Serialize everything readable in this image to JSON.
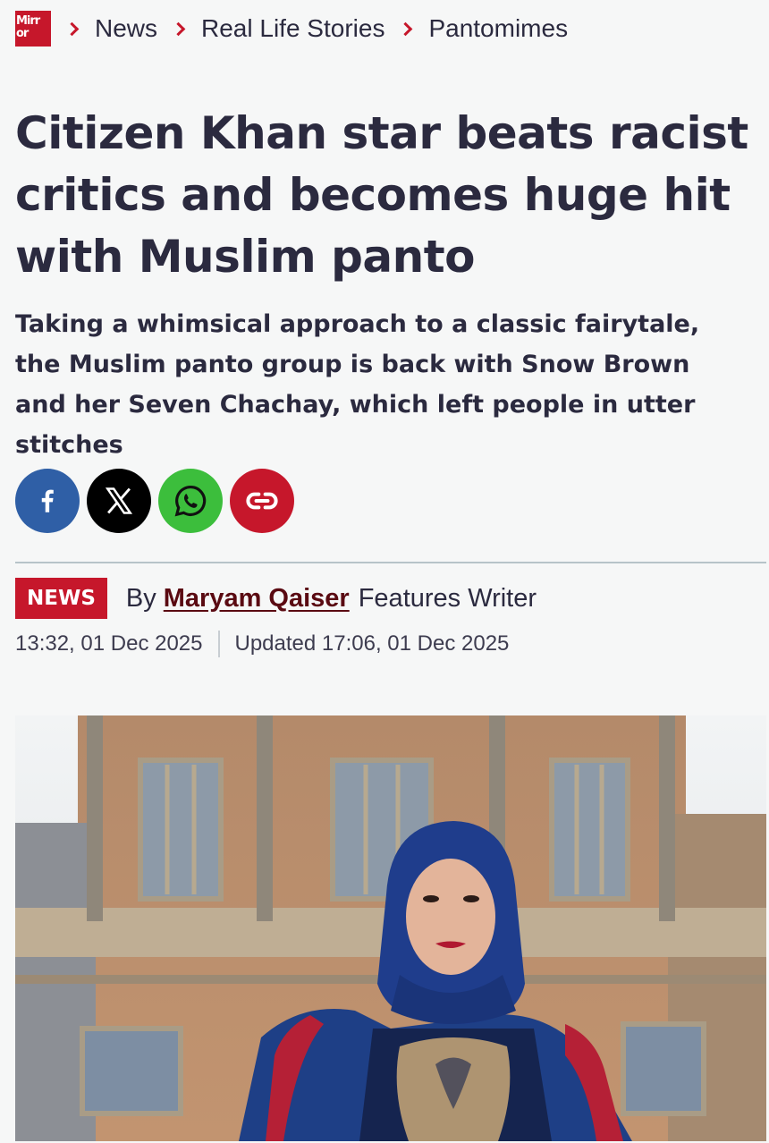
{
  "breadcrumb": {
    "logo_line1": "Mirr",
    "logo_line2": "or",
    "items": [
      "News",
      "Real Life Stories",
      "Pantomimes"
    ]
  },
  "article": {
    "headline": "Citizen Khan star beats racist critics and becomes huge hit with Muslim panto",
    "standfirst": "Taking a whimsical approach to a classic fairytale, the Muslim panto group is back with Snow Brown and her Seven Chachay, which left people in utter stitches"
  },
  "share": {
    "buttons": [
      {
        "icon": "facebook-icon",
        "color": "#2f5fa6"
      },
      {
        "icon": "x-icon",
        "color": "#000000"
      },
      {
        "icon": "whatsapp-icon",
        "color": "#3cbe3c"
      },
      {
        "icon": "link-icon",
        "color": "#c6172b"
      }
    ]
  },
  "byline": {
    "tag": "NEWS",
    "by": "By",
    "author": "Maryam Qaiser",
    "role": "Features Writer",
    "published": "13:32, 01 Dec 2025",
    "updated": "Updated 17:06, 01 Dec 2025"
  },
  "colors": {
    "brand_red": "#c6172b",
    "text": "#2b2a3f",
    "author_link": "#5a0a12"
  }
}
